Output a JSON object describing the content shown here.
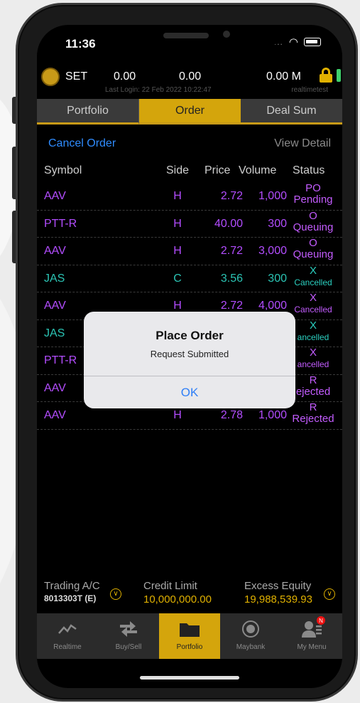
{
  "status_bar": {
    "time": "11:36",
    "dots": "...",
    "wifi_glyph": "◠"
  },
  "ticker": {
    "index_name": "SET",
    "value1": "0.00",
    "value2": "0.00",
    "value3": "0.00 M",
    "last_login": "Last Login: 22 Feb 2022 10:22:47",
    "mode": "realtimetest"
  },
  "tabs": [
    {
      "label": "Portfolio",
      "active": false
    },
    {
      "label": "Order",
      "active": true
    },
    {
      "label": "Deal Sum",
      "active": false
    }
  ],
  "actions": {
    "cancel_order": "Cancel Order",
    "view_detail": "View Detail"
  },
  "table": {
    "headers": {
      "symbol": "Symbol",
      "side": "Side",
      "price": "Price",
      "volume": "Volume",
      "status": "Status"
    },
    "rows": [
      {
        "symbol": "AAV",
        "side": "H",
        "price": "2.72",
        "volume": "1,000",
        "status_code": "PO",
        "status_text": "Pending",
        "color": "purple"
      },
      {
        "symbol": "PTT-R",
        "side": "H",
        "price": "40.00",
        "volume": "300",
        "status_code": "O",
        "status_text": "Queuing",
        "color": "purple"
      },
      {
        "symbol": "AAV",
        "side": "H",
        "price": "2.72",
        "volume": "3,000",
        "status_code": "O",
        "status_text": "Queuing",
        "color": "purple"
      },
      {
        "symbol": "JAS",
        "side": "C",
        "price": "3.56",
        "volume": "300",
        "status_code": "X",
        "status_text": "Cancelled",
        "color": "teal"
      },
      {
        "symbol": "AAV",
        "side": "H",
        "price": "2.72",
        "volume": "4,000",
        "status_code": "X",
        "status_text": "Cancelled",
        "color": "purple"
      },
      {
        "symbol": "JAS",
        "side": "",
        "price": "",
        "volume": "",
        "status_code": "X",
        "status_text": "ancelled",
        "color": "teal"
      },
      {
        "symbol": "PTT-R",
        "side": "",
        "price": "",
        "volume": "",
        "status_code": "X",
        "status_text": "ancelled",
        "color": "purple"
      },
      {
        "symbol": "AAV",
        "side": "",
        "price": "",
        "volume": "",
        "status_code": "R",
        "status_text": "ejected",
        "color": "purple"
      },
      {
        "symbol": "AAV",
        "side": "H",
        "price": "2.78",
        "volume": "1,000",
        "status_code": "R",
        "status_text": "Rejected",
        "color": "purple"
      }
    ]
  },
  "dialog": {
    "title": "Place Order",
    "message": "Request Submitted",
    "ok": "OK"
  },
  "account": {
    "trading_label": "Trading A/C",
    "trading_value": "8013303T (E)",
    "credit_label": "Credit Limit",
    "credit_value": "10,000,000.00",
    "equity_label": "Excess Equity",
    "equity_value": "19,988,539.93"
  },
  "tabbar": [
    {
      "label": "Realtime",
      "icon": "chart-line-icon",
      "active": false
    },
    {
      "label": "Buy/Sell",
      "icon": "swap-arrows-icon",
      "active": false
    },
    {
      "label": "Portfolio",
      "icon": "folder-icon",
      "active": true
    },
    {
      "label": "Maybank",
      "icon": "maybank-logo-icon",
      "active": false
    },
    {
      "label": "My Menu",
      "icon": "user-menu-icon",
      "active": false,
      "badge": "N"
    }
  ],
  "colors": {
    "gold": "#d4a50c",
    "purple": "#b34dff",
    "teal": "#2bc4b4",
    "link_blue": "#2f8cff"
  }
}
